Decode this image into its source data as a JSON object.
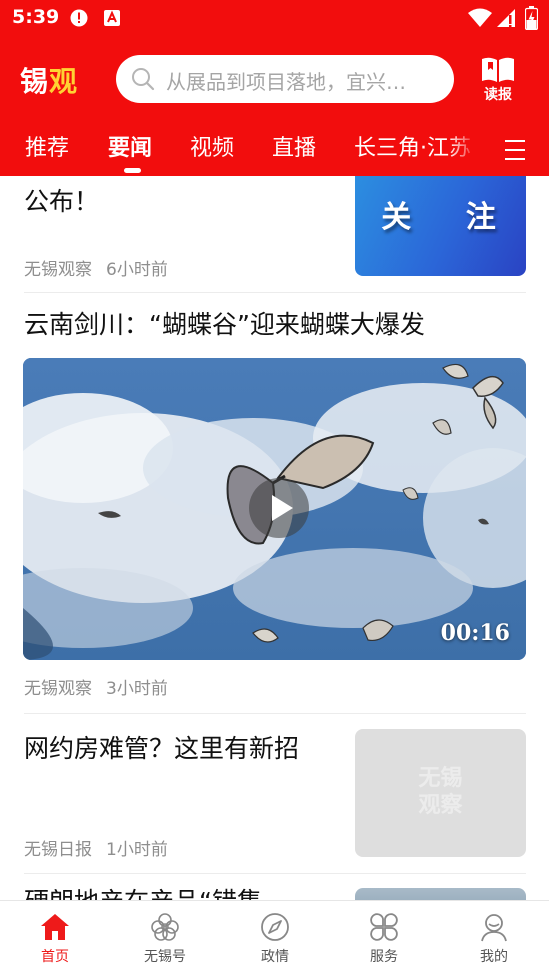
{
  "status_bar": {
    "time": "5:39",
    "icons": [
      "alert-circle-icon",
      "app-notification-icon",
      "wifi-icon",
      "signal-icon",
      "battery-charging-icon"
    ]
  },
  "header": {
    "logo_part1": "锡",
    "logo_part2": "观",
    "search_placeholder": "从展品到项目落地，宜兴…",
    "reader_label": "读报",
    "tabs": [
      {
        "label": "推荐",
        "active": false
      },
      {
        "label": "要闻",
        "active": true
      },
      {
        "label": "视频",
        "active": false
      },
      {
        "label": "直播",
        "active": false
      },
      {
        "label": "长三角·江苏",
        "active": false
      }
    ]
  },
  "feed": {
    "articles": [
      {
        "title": "公布！",
        "source": "无锡观察",
        "time": "6小时前",
        "thumb_text": "关 注",
        "thumb_style": "blue-banner"
      },
      {
        "title": "云南剑川：“蝴蝶谷”迎来蝴蝶大爆发",
        "source": "无锡观察",
        "time": "3小时前",
        "video_duration": "00:16"
      },
      {
        "title": "网约房难管？这里有新招",
        "source": "无锡日报",
        "time": "1小时前",
        "thumb_watermark_line1": "无锡",
        "thumb_watermark_line2": "观察"
      },
      {
        "title": "硬朗地产在产品“错集",
        "partial": true
      }
    ]
  },
  "bottom_nav": {
    "items": [
      {
        "label": "首页",
        "icon": "home-icon",
        "active": true
      },
      {
        "label": "无锡号",
        "icon": "flower-icon",
        "active": false
      },
      {
        "label": "政情",
        "icon": "compass-icon",
        "active": false
      },
      {
        "label": "服务",
        "icon": "grid-petals-icon",
        "active": false
      },
      {
        "label": "我的",
        "icon": "user-icon",
        "active": false
      }
    ]
  },
  "colors": {
    "brand_red": "#f20d0d",
    "logo_yellow": "#ffd233",
    "meta_gray": "#8e8e8e",
    "nav_active": "#ee1a1a"
  }
}
